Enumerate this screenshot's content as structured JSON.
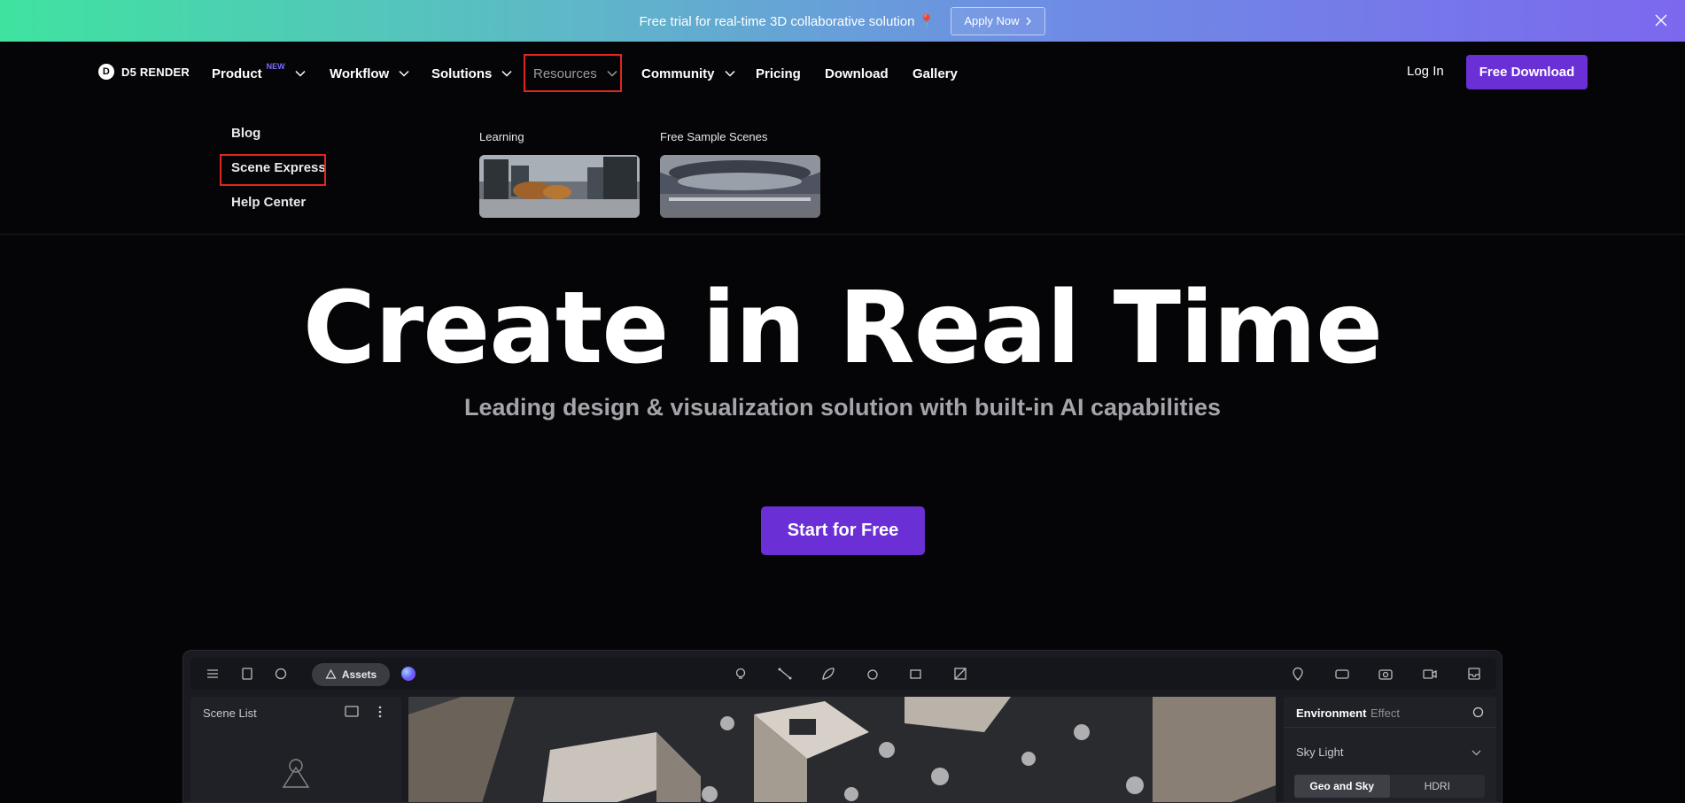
{
  "banner": {
    "text": "Free trial for real-time 3D collaborative solution",
    "pin": "📍",
    "apply_label": "Apply Now"
  },
  "nav": {
    "logo_letter": "D",
    "logo_text": "D5 RENDER",
    "items": [
      {
        "label": "Product",
        "badge": "NEW"
      },
      {
        "label": "Workflow"
      },
      {
        "label": "Solutions"
      },
      {
        "label": "Resources"
      },
      {
        "label": "Community"
      },
      {
        "label": "Pricing"
      },
      {
        "label": "Download"
      },
      {
        "label": "Gallery"
      }
    ],
    "login": "Log In",
    "free_download": "Free Download"
  },
  "resources_menu": {
    "links": [
      "Blog",
      "Scene Express",
      "Help Center"
    ],
    "cards": [
      {
        "label": "Learning"
      },
      {
        "label": "Free Sample Scenes"
      }
    ]
  },
  "hero": {
    "title": "Create in Real Time",
    "subtitle": "Leading design & visualization solution with built-in AI capabilities",
    "cta": "Start for Free"
  },
  "app_preview": {
    "assets_label": "Assets",
    "scene_list_title": "Scene List",
    "env_tabs": [
      "Environment",
      "Effect"
    ],
    "sky_light": "Sky Light",
    "segments": [
      "Geo and Sky",
      "HDRI"
    ]
  }
}
